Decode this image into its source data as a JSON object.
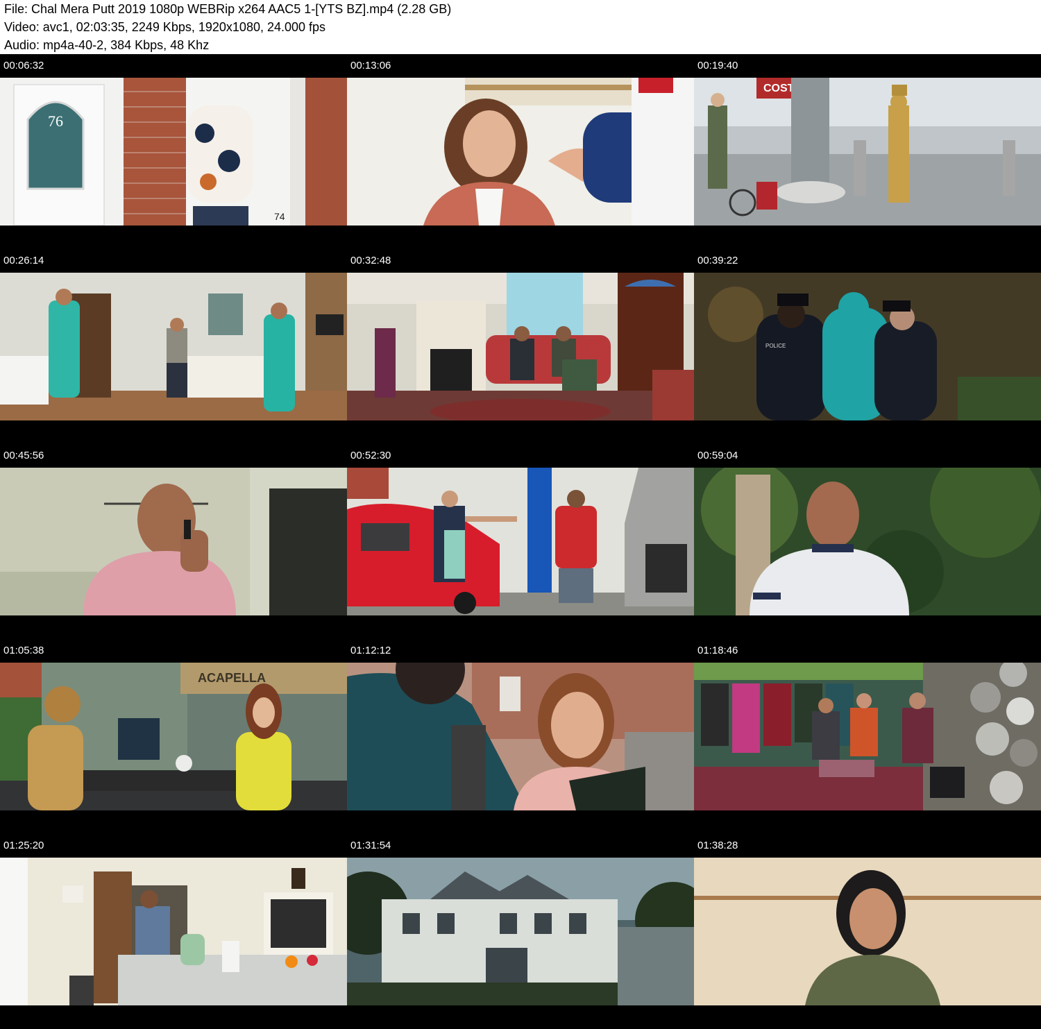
{
  "header": {
    "file_line": "File: Chal Mera Putt 2019 1080p WEBRip x264 AAC5 1-[YTS BZ].mp4 (2.28 GB)",
    "video_line": "Video: avc1, 02:03:35, 2249 Kbps, 1920x1080, 24.000 fps",
    "audio_line": "Audio: mp4a-40-2, 384 Kbps, 48 Khz"
  },
  "thumbnails": [
    {
      "timestamp": "00:06:32",
      "scene": "front-door-76",
      "door_number": "76",
      "plate": "74"
    },
    {
      "timestamp": "00:13:06",
      "scene": "woman-on-bed"
    },
    {
      "timestamp": "00:19:40",
      "scene": "street-gold-statue",
      "sign": "COST"
    },
    {
      "timestamp": "00:26:14",
      "scene": "living-room-three-men"
    },
    {
      "timestamp": "00:32:48",
      "scene": "men-on-red-sofa"
    },
    {
      "timestamp": "00:39:22",
      "scene": "police-night",
      "label": "POLICE"
    },
    {
      "timestamp": "00:45:56",
      "scene": "man-on-phone-kitchen"
    },
    {
      "timestamp": "00:52:30",
      "scene": "red-car-fist-bump"
    },
    {
      "timestamp": "00:59:04",
      "scene": "man-in-park"
    },
    {
      "timestamp": "01:05:38",
      "scene": "cafe-acapella",
      "sign": "ACAPELLA"
    },
    {
      "timestamp": "01:12:12",
      "scene": "smiling-woman-street"
    },
    {
      "timestamp": "01:18:46",
      "scene": "clothing-shop-clocks"
    },
    {
      "timestamp": "01:25:20",
      "scene": "kitchen-phone-call"
    },
    {
      "timestamp": "01:31:54",
      "scene": "white-house-exterior"
    },
    {
      "timestamp": "01:38:28",
      "scene": "woman-close-up"
    }
  ]
}
